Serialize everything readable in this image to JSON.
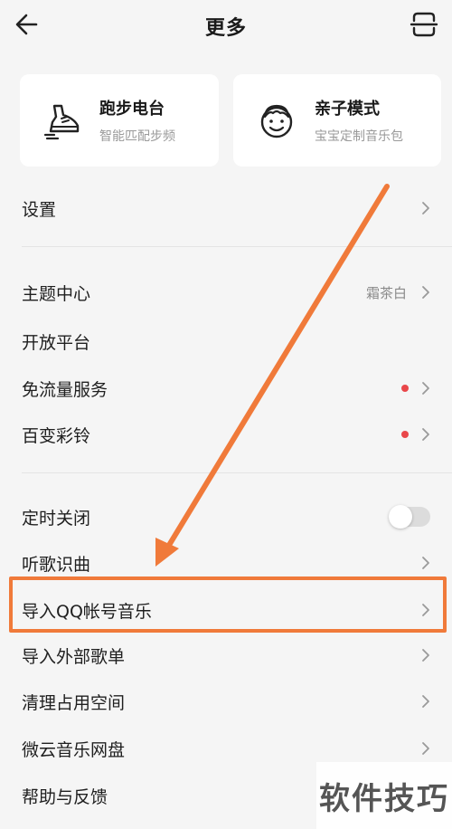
{
  "header": {
    "title": "更多",
    "back_icon": "arrow-left-icon",
    "scan_icon": "scan-icon"
  },
  "cards": [
    {
      "title": "跑步电台",
      "subtitle": "智能匹配步频",
      "icon": "running-shoe-icon"
    },
    {
      "title": "亲子模式",
      "subtitle": "宝宝定制音乐包",
      "icon": "child-face-icon"
    }
  ],
  "settings": {
    "label": "设置"
  },
  "group2": [
    {
      "label": "主题中心",
      "value": "霜茶白"
    },
    {
      "label": "开放平台"
    },
    {
      "label": "免流量服务",
      "badge": "red-dot"
    },
    {
      "label": "百变彩铃",
      "badge": "red-dot"
    }
  ],
  "group3": [
    {
      "label": "定时关闭",
      "toggle": false
    },
    {
      "label": "听歌识曲"
    },
    {
      "label": "导入QQ帐号音乐"
    },
    {
      "label": "导入外部歌单"
    },
    {
      "label": "清理占用空间"
    },
    {
      "label": "微云音乐网盘"
    },
    {
      "label": "帮助与反馈"
    }
  ],
  "annotation": {
    "color": "#f07a3a"
  },
  "watermark": "软件技巧"
}
